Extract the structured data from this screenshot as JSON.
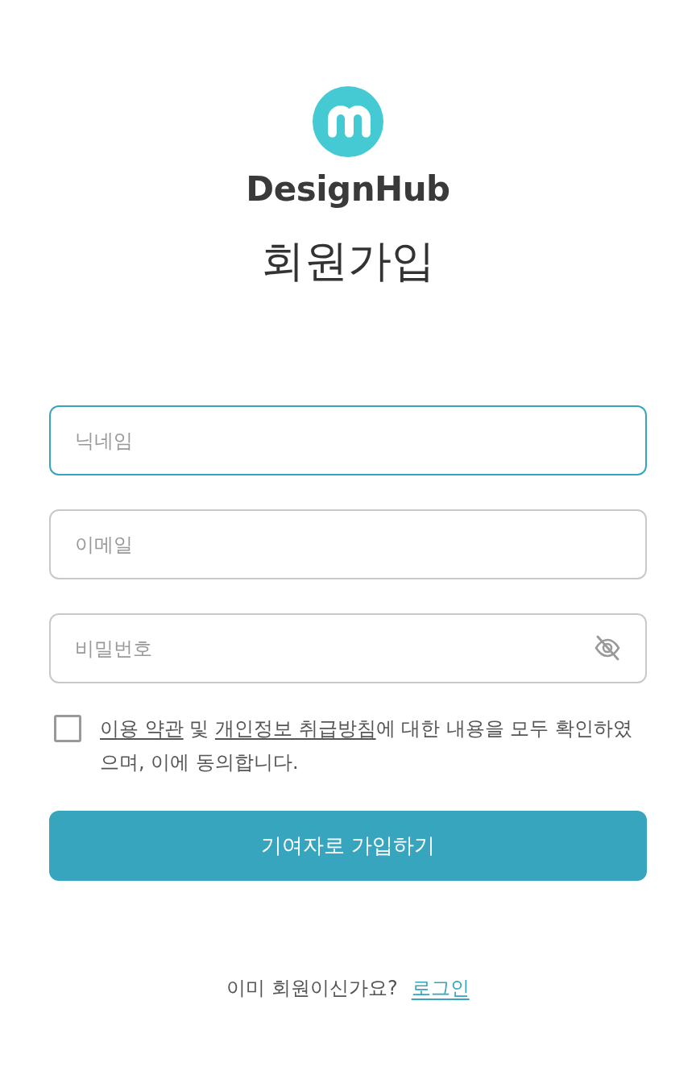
{
  "logo": {
    "brand": "DesignHub"
  },
  "title": "회원가입",
  "fields": [
    {
      "kind": "text",
      "placeholder": "닉네임",
      "focused": true
    },
    {
      "kind": "email",
      "placeholder": "이메일",
      "focused": false
    },
    {
      "kind": "password",
      "placeholder": "비밀번호",
      "focused": false
    }
  ],
  "agreement": {
    "checked": false,
    "parts": [
      {
        "kind": "link",
        "text": "이용 약관"
      },
      {
        "kind": "text",
        "text": " 및 "
      },
      {
        "kind": "link",
        "text": "개인정보 취급방침"
      },
      {
        "kind": "text",
        "text": "에 대한 내용을 모두 확인하였으며, 이에 동의합니다."
      }
    ]
  },
  "submit_button": {
    "label": "기여자로 가입하기"
  },
  "login_prompt": {
    "text": "이미 회원이신가요?",
    "link": "로그인"
  }
}
